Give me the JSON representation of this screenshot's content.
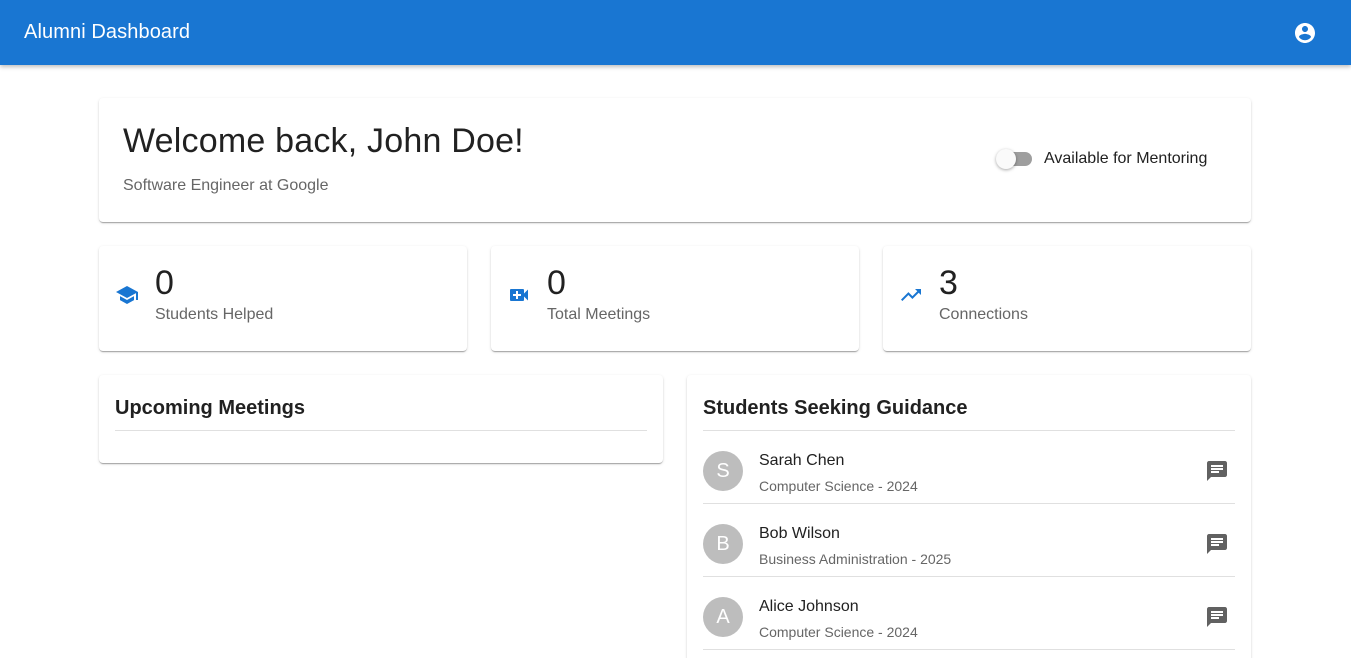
{
  "appbar": {
    "title": "Alumni Dashboard",
    "account_icon": "account-circle-icon"
  },
  "welcome": {
    "title": "Welcome back, John Doe!",
    "subtitle": "Software Engineer at Google",
    "mentoring_label": "Available for Mentoring",
    "mentoring_enabled": false
  },
  "stats": [
    {
      "icon": "graduation-cap-icon",
      "value": "0",
      "label": "Students Helped"
    },
    {
      "icon": "video-call-icon",
      "value": "0",
      "label": "Total Meetings"
    },
    {
      "icon": "trending-up-icon",
      "value": "3",
      "label": "Connections"
    }
  ],
  "meetings": {
    "title": "Upcoming Meetings",
    "items": []
  },
  "students": {
    "title": "Students Seeking Guidance",
    "items": [
      {
        "initial": "S",
        "name": "Sarah Chen",
        "meta": "Computer Science - 2024",
        "action_icon": "chat-icon"
      },
      {
        "initial": "B",
        "name": "Bob Wilson",
        "meta": "Business Administration - 2025",
        "action_icon": "chat-icon"
      },
      {
        "initial": "A",
        "name": "Alice Johnson",
        "meta": "Computer Science - 2024",
        "action_icon": "chat-icon"
      }
    ]
  },
  "colors": {
    "primary": "#1976d2",
    "avatar_bg": "#bdbdbd",
    "icon_gray": "#616161"
  }
}
